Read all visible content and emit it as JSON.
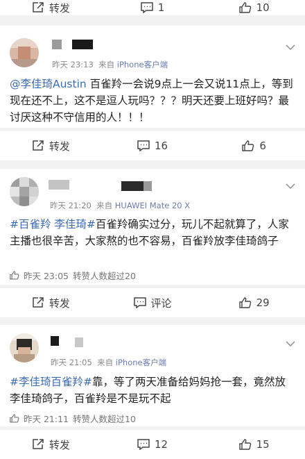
{
  "top_bar": {
    "repost_label": "转发",
    "comment_count": "1",
    "like_count": "10"
  },
  "comments": [
    {
      "time": "昨天 23:13",
      "source_prefix": "来自",
      "source": "iPhone客户端",
      "mention": "@李佳琦Austin",
      "text": " 百雀羚一会说9点上一会又说11点上，等到现在还不上，这不是逗人玩吗？？？明天还要上班好吗？最讨厌这种不守信用的人！！！",
      "repost_label": "转发",
      "comment_count": "16",
      "like_count": "6"
    },
    {
      "time": "昨天 21:20",
      "source_prefix": "来自",
      "source": "HUAWEI Mate 20 X",
      "hashtag": "#百雀羚 李佳琦#",
      "text": "百雀羚确实过分，玩儿不起就算了，人家主播也很辛苦，大家熬的也不容易，百雀羚放李佳琦鸽子",
      "sub_time": "昨天 23:05",
      "sub_text": "转赞人数超过20",
      "repost_label": "转发",
      "comment_label": "评论",
      "like_count": "29"
    },
    {
      "time": "昨天 21:05",
      "source_prefix": "来自",
      "source": "iPhone客户端",
      "hashtag": "#李佳琦百雀羚#",
      "text": "靠，等了两天准备给妈妈抢一套，竟然放李佳琦鸽子，百雀羚是不是玩不起",
      "sub_time": "昨天 21:11",
      "sub_text": "转赞人数超过10",
      "repost_label": "转发",
      "comment_count": "12",
      "like_count": "15"
    }
  ],
  "icons": {
    "repost": "repost-icon",
    "comment": "comment-icon",
    "like": "thumbs-up-icon",
    "expand": "chevron-down-icon",
    "hot": "like-count-icon"
  }
}
